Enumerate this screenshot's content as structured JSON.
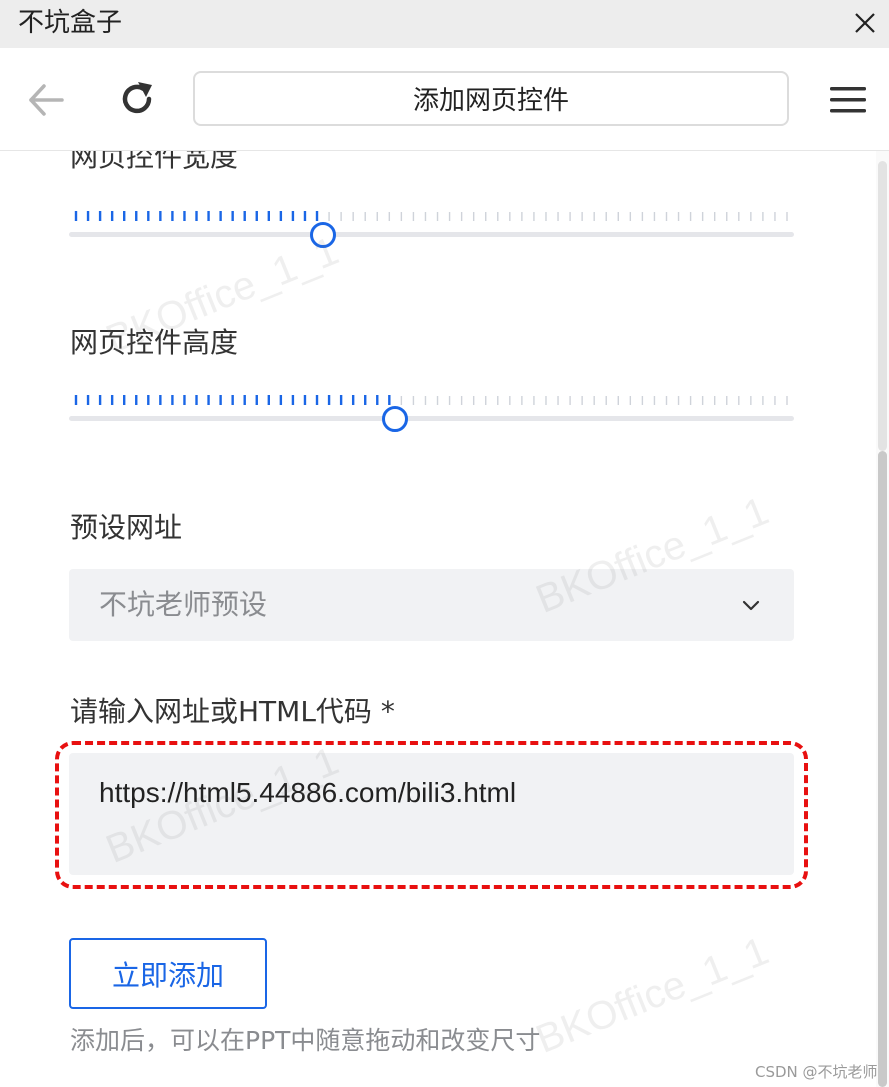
{
  "window": {
    "title": "不坑盒子"
  },
  "toolbar": {
    "address_text": "添加网页控件"
  },
  "form": {
    "width_label": "网页控件宽度",
    "width_value_fraction": 0.35,
    "height_label": "网页控件高度",
    "height_value_fraction": 0.45,
    "preset_label": "预设网址",
    "preset_selected": "不坑老师预设",
    "url_label": "请输入网址或HTML代码 *",
    "url_value": "https://html5.44886.com/bili3.html",
    "add_button_label": "立即添加",
    "hint": "添加后，可以在PPT中随意拖动和改变尺寸"
  },
  "watermark_text": "BKOffice_1_1",
  "credit": "CSDN @不坑老师",
  "colors": {
    "accent": "#1a66e6",
    "highlight": "#e81010",
    "field_bg": "#f1f2f4"
  },
  "icons": {
    "close": "close-icon",
    "back": "back-arrow-icon",
    "refresh": "refresh-icon",
    "menu": "menu-icon",
    "dropdown": "chevron-down-icon"
  }
}
